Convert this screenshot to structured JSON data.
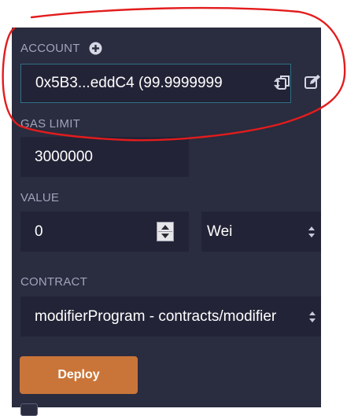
{
  "account": {
    "label": "ACCOUNT",
    "value": "0x5B3...eddC4 (99.9999999",
    "add_icon": "plus-circle-icon",
    "copy_icon": "copy-icon",
    "edit_icon": "edit-icon"
  },
  "gas_limit": {
    "label": "GAS LIMIT",
    "value": "3000000"
  },
  "value": {
    "label": "VALUE",
    "amount": "0",
    "unit": "Wei"
  },
  "contract": {
    "label": "CONTRACT",
    "selected": "modifierProgram - contracts/modifier"
  },
  "deploy_label": "Deploy",
  "colors": {
    "panel_bg": "#2a2c3f",
    "input_bg": "#222336",
    "label": "#a2a3bd",
    "deploy": "#c97539",
    "annotation": "#e31c1c",
    "focus_border": "#2f6f86"
  }
}
